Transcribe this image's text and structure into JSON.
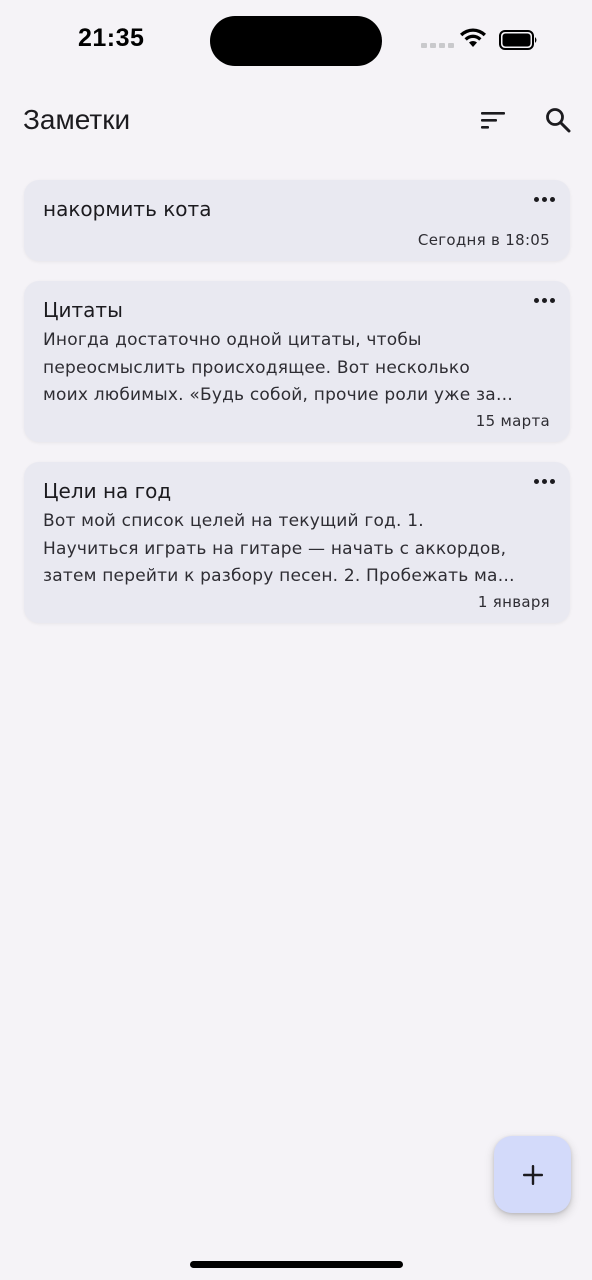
{
  "status_bar": {
    "time": "21:35"
  },
  "app_bar": {
    "title": "Заметки",
    "sort_icon": "sort-icon",
    "search_icon": "search-icon"
  },
  "notes": [
    {
      "title": "накормить кота",
      "body_lines": [],
      "date": "Сегодня в 18:05"
    },
    {
      "title": "Цитаты",
      "body_lines": [
        "Иногда достаточно одной цитаты, чтобы",
        "переосмыслить происходящее. Вот несколько",
        "моих любимых. «Будь собой, прочие роли уже за…"
      ],
      "date": "15 марта"
    },
    {
      "title": "Цели на год",
      "body_lines": [
        "Вот мой список целей на текущий год. 1.",
        "Научиться играть на гитаре — начать с аккордов,",
        "затем перейти к разбору песен. 2. Пробежать ма…"
      ],
      "date": "1 января"
    }
  ],
  "fab": {
    "icon": "plus-icon",
    "label": "+"
  },
  "colors": {
    "background": "#f5f3f7",
    "card": "#e9e9f1",
    "fab": "#d3dafa",
    "text": "#1c1b1f"
  }
}
